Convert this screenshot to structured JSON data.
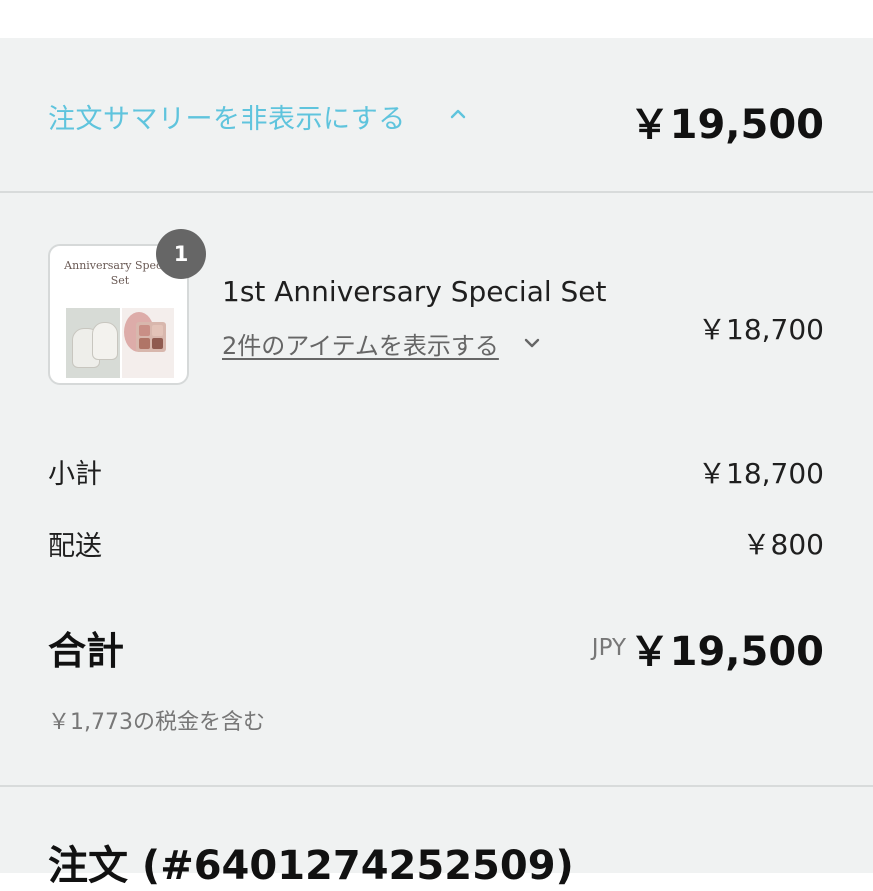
{
  "header": {
    "toggle_label": "注文サマリーを非表示にする",
    "toggle_icon": "chevron-up-icon",
    "total": "￥19,500"
  },
  "product": {
    "quantity": "1",
    "thumbnail_title": "Anniversary Special Set",
    "name": "1st Anniversary Special Set",
    "show_items_label": "2件のアイテムを表示する",
    "show_items_icon": "chevron-down-icon",
    "price": "￥18,700"
  },
  "summary_lines": {
    "subtotal_label": "小計",
    "subtotal_value": "￥18,700",
    "shipping_label": "配送",
    "shipping_value": "￥800"
  },
  "total": {
    "label": "合計",
    "currency": "JPY",
    "value": "￥19,500",
    "tax_note": "￥1,773の税金を含む"
  },
  "order": {
    "number_label": "注文 (#6401274252509)"
  },
  "colors": {
    "accent_link": "#5fc4dd",
    "panel_bg": "#f0f2f2",
    "badge_bg": "#666666"
  }
}
